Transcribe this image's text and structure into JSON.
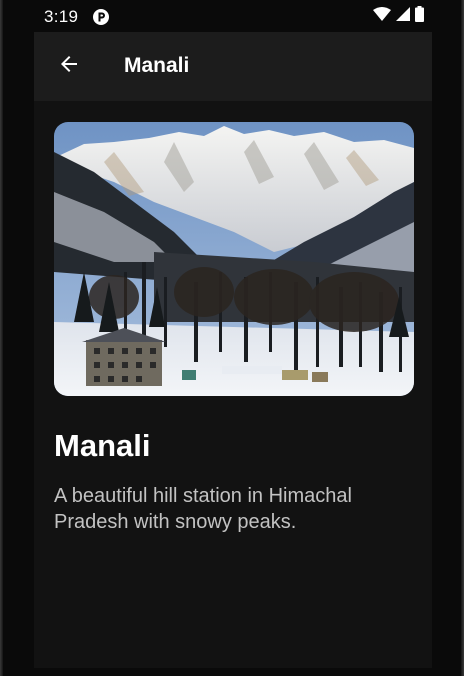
{
  "status_bar": {
    "time": "3:19",
    "icons": [
      "app-notification-icon",
      "wifi-icon",
      "cell-signal-icon",
      "battery-icon"
    ]
  },
  "app_bar": {
    "back_icon": "arrow-back-icon",
    "title": "Manali"
  },
  "place": {
    "image_subject": "snowy-mountain-valley-photo",
    "name": "Manali",
    "description": "A beautiful hill station in Himachal Pradesh with snowy peaks."
  },
  "colors": {
    "background": "#121212",
    "app_bar": "#1c1c1c",
    "title_text": "#ffffff",
    "body_text": "#c2c2c2"
  }
}
